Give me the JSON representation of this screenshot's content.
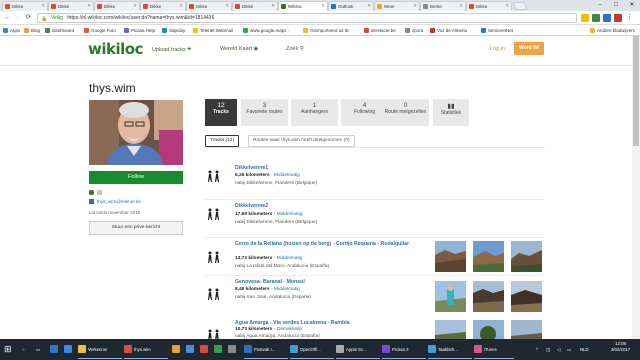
{
  "browser": {
    "tabs": [
      {
        "label": "Dikke"
      },
      {
        "label": "Dikke"
      },
      {
        "label": "Dikke"
      },
      {
        "label": "Dikke"
      },
      {
        "label": "Dikke"
      },
      {
        "label": "Dikke"
      },
      {
        "label": "Wikiloc"
      },
      {
        "label": "Outlook"
      },
      {
        "label": "Weer"
      },
      {
        "label": "Bertie"
      },
      {
        "label": "Dikke"
      }
    ],
    "window_controls": {
      "minimize": "–",
      "maximize": "□",
      "close": "✕"
    },
    "address": {
      "safe_label": "Veilig",
      "url": "https://nl.wikiloc.com/wikiloc/user.do?name=thys.wim&id=1814436"
    },
    "nav": {
      "back": "←",
      "forward": "→",
      "reload": "⟳"
    }
  },
  "bookmarks": [
    {
      "label": "Apps",
      "color": "#4a7fd8"
    },
    {
      "label": "Blog",
      "color": "#f0a030"
    },
    {
      "label": "Dashboard",
      "color": "#3c8a3c"
    },
    {
      "label": "Google Foto",
      "color": "#e05a3a"
    },
    {
      "label": "Picasa Help",
      "color": "#7a5ad8"
    },
    {
      "label": "Sapulay",
      "color": "#2c7fc0"
    },
    {
      "label": "Telenet Webmail",
      "color": "#f7c400"
    },
    {
      "label": "www.google.maps -",
      "color": "#36a852"
    },
    {
      "label": "Geimporteerd uit IE",
      "color": "#e8b73a"
    },
    {
      "label": "derelacte.be",
      "color": "#d84a3a"
    },
    {
      "label": "zpora",
      "color": "#888888"
    },
    {
      "label": "Voz de Almeria",
      "color": "#c0392b"
    },
    {
      "label": "SeniorenNet",
      "color": "#2a7ac8"
    },
    {
      "label": "Andere bladwijzers",
      "color": "#e8b73a"
    }
  ],
  "site": {
    "logo": "wikiloc",
    "nav": {
      "upload": "Upload tracks",
      "world_map": "Wereld Kaart",
      "search": "Zoek"
    },
    "login": "Log in",
    "join": "Word lid"
  },
  "profile": {
    "username": "thys.wim",
    "follow": "Follow",
    "email": "thys_wim@telenet.be",
    "member_since": "Lid sinds november 2015",
    "message": "Stuur een prive-bericht"
  },
  "stats": [
    {
      "num": "12",
      "label": "Tracks",
      "active": true
    },
    {
      "num": "3",
      "label": "Favoriete routes",
      "active": false
    },
    {
      "num": "1",
      "label": "Aanhangers",
      "active": false
    },
    {
      "num": "4",
      "label": "Following",
      "active": false
    },
    {
      "num": "0",
      "label": "Route metgezellen",
      "active": false
    },
    {
      "num": "",
      "label": "Statistiek",
      "active": false
    }
  ],
  "subtabs": [
    {
      "label": "Tracks (12)",
      "active": true
    },
    {
      "label": "Routes waar thys.wim heeft deelgenomen (0)",
      "active": false
    }
  ],
  "tracks": [
    {
      "name": "Dikkelvenne1",
      "distance": "6,26 kilometers",
      "difficulty": "Middelmatig",
      "location": "nabij Dikkelvenne, Flanders (Belgique)",
      "photos": []
    },
    {
      "name": "Dikkelvenne2",
      "distance": "17,69 kilometers",
      "difficulty": "Middelmatig",
      "location": "nabij Dikkelvenne, Flanders (Belgique)",
      "photos": []
    },
    {
      "name": "Cerro de la Reliana (huizen op de berg) - Cortijo Requena - Rodalquilar",
      "distance": "13,72 kilometers",
      "difficulty": "Middelmatig",
      "location": "nabij La Isleta del Moro, Andalucía (España)",
      "photos": [
        "p1",
        "p2",
        "p3"
      ]
    },
    {
      "name": "Genovesa- Baranal - Monsul",
      "distance": "8,46 kilometers",
      "difficulty": "Middelmatig",
      "location": "nabij San José, Andalucía (España)",
      "photos": [
        "p4",
        "p5",
        "p6"
      ]
    },
    {
      "name": "Agua Amarga - Vía verdes Lucainena - Rambla",
      "distance": "10,73 kilometers",
      "difficulty": "Gemakkelijk",
      "location": "nabij Agua Amarga, Andalucía (España)",
      "photos": [
        "p7",
        "p8",
        "p9"
      ]
    }
  ],
  "taskbar": {
    "items": [
      {
        "label": "Verkenner",
        "color": "#f0c040"
      },
      {
        "label": "thys.wim",
        "color": "#e04a3a"
      },
      {
        "label": "Postvak I...",
        "color": "#2a6fc8"
      },
      {
        "label": "OpenOffi...",
        "color": "#3aa0e0"
      },
      {
        "label": "Apple Sc...",
        "color": "#aaaaaa"
      },
      {
        "label": "Picasa 3",
        "color": "#7a4ad0"
      },
      {
        "label": "Taakbeh...",
        "color": "#3aa0e0"
      },
      {
        "label": "iTunes",
        "color": "#e0508a"
      }
    ],
    "tray": "NLD",
    "time": "12:08",
    "date": "3/02/2017"
  }
}
